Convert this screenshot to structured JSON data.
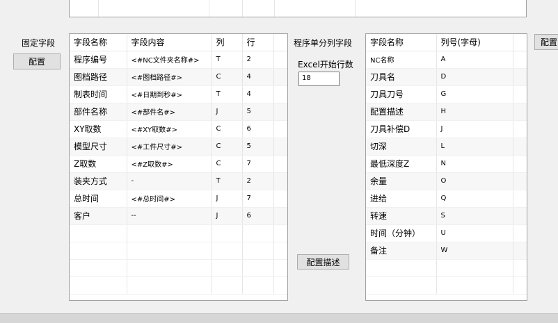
{
  "fixed_fields": {
    "label": "固定字段",
    "config_button": "配置",
    "columns": [
      "字段名称",
      "字段内容",
      "列",
      "行"
    ],
    "rows": [
      {
        "name": "程序编号",
        "content": "<#NC文件夹名称#>",
        "col": "T",
        "row": "2"
      },
      {
        "name": "图档路径",
        "content": "<#图档路径#>",
        "col": "C",
        "row": "4"
      },
      {
        "name": "制表时间",
        "content": "<#日期到秒#>",
        "col": "T",
        "row": "4"
      },
      {
        "name": "部件名称",
        "content": "<#部件名#>",
        "col": "J",
        "row": "5"
      },
      {
        "name": "XY取数",
        "content": "<#XY取数#>",
        "col": "C",
        "row": "6"
      },
      {
        "name": "模型尺寸",
        "content": "<#工件尺寸#>",
        "col": "C",
        "row": "5"
      },
      {
        "name": "Z取数",
        "content": "<#Z取数#>",
        "col": "C",
        "row": "7"
      },
      {
        "name": "装夹方式",
        "content": "-",
        "col": "T",
        "row": "2"
      },
      {
        "name": "总时间",
        "content": "<#总时间#>",
        "col": "J",
        "row": "7"
      },
      {
        "name": "客户",
        "content": "--",
        "col": "J",
        "row": "6"
      }
    ]
  },
  "program_columns": {
    "label": "程序单分列字段",
    "excel_start_label": "Excel开始行数",
    "excel_start_value": "18",
    "config_desc_button": "配置描述",
    "columns": [
      "字段名称",
      "列号(字母)"
    ],
    "rows": [
      {
        "name": "NC名称",
        "letter": "A"
      },
      {
        "name": "刀具名",
        "letter": "D"
      },
      {
        "name": "刀具刀号",
        "letter": "G"
      },
      {
        "name": "配置描述",
        "letter": "H"
      },
      {
        "name": "刀具补偿D",
        "letter": "J"
      },
      {
        "name": "切深",
        "letter": "L"
      },
      {
        "name": "最低深度Z",
        "letter": "N"
      },
      {
        "name": "余量",
        "letter": "O"
      },
      {
        "name": "进给",
        "letter": "Q"
      },
      {
        "name": "转速",
        "letter": "S"
      },
      {
        "name": "时间（分钟）",
        "letter": "U"
      },
      {
        "name": "备注",
        "letter": "W"
      }
    ]
  },
  "right_config_button": "配置"
}
